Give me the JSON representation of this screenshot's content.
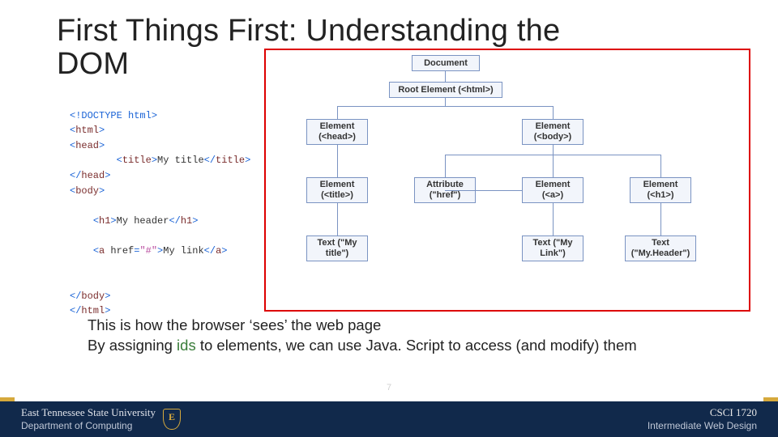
{
  "title": {
    "line1": "First Things First: Understanding the",
    "line2": "DOM"
  },
  "code": {
    "l1": "<!DOCTYPE html>",
    "l2a": "<",
    "l2b": "html",
    "l2c": ">",
    "l3a": "<",
    "l3b": "head",
    "l3c": ">",
    "l4a": "<",
    "l4b": "title",
    "l4c": ">",
    "l4d": "My title",
    "l4e": "</",
    "l4f": "title",
    "l4g": ">",
    "l5a": "</",
    "l5b": "head",
    "l5c": ">",
    "l6a": "<",
    "l6b": "body",
    "l6c": ">",
    "l8a": "<",
    "l8b": "h1",
    "l8c": ">",
    "l8d": "My header",
    "l8e": "</",
    "l8f": "h1",
    "l8g": ">",
    "l10a": "<",
    "l10b": "a",
    "l10c": "href",
    "l10d": "=",
    "l10e": "\"#\"",
    "l10f": ">",
    "l10g": "My link",
    "l10h": "</",
    "l10i": "a",
    "l10j": ">",
    "l13a": "</",
    "l13b": "body",
    "l13c": ">",
    "l14a": "</",
    "l14b": "html",
    "l14c": ">"
  },
  "tree": {
    "document": "Document",
    "root": "Root Element (<html>)",
    "head": "Element (<head>)",
    "body": "Element (<body>)",
    "title": "Element (<title>)",
    "href": "Attribute (\"href\")",
    "a": "Element (<a>)",
    "h1": "Element (<h1>)",
    "t_title": "Text (\"My title\")",
    "t_link": "Text (\"My Link\")",
    "t_header": "Text (\"My.Header\")"
  },
  "body": {
    "line1": "This is how the browser ‘sees’ the web page",
    "line2a": "By assigning ",
    "id_token": "ids",
    "line2b": " to elements, we can use Java. Script to access (and modify) them"
  },
  "footer": {
    "university": "East Tennessee State University",
    "department": "Department of Computing",
    "course_code": "CSCI 1720",
    "course_name": "Intermediate Web Design",
    "page": "7"
  }
}
